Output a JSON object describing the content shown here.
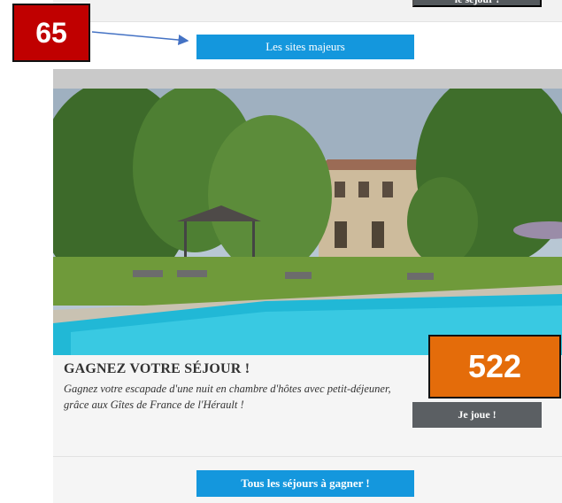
{
  "top": {
    "cut_button_label": "le séjour !"
  },
  "annotations": {
    "badge_top": "65",
    "badge_bottom": "522"
  },
  "buttons": {
    "sites_majeurs": "Les sites majeurs",
    "tous_sejours": "Tous les séjours à gagner !",
    "je_joue": "Je joue !"
  },
  "promo": {
    "title": "GAGNEZ VOTRE SÉJOUR !",
    "description": "Gagnez votre escapade d'une nuit en chambre d'hôtes avec petit-déjeuner, grâce aux Gîtes de France de l'Hérault !"
  },
  "colors": {
    "badge_red": "#c00000",
    "badge_orange": "#e46c0a",
    "button_blue": "#1497dd",
    "button_gray": "#5b5f63",
    "arrow": "#4472c4"
  }
}
